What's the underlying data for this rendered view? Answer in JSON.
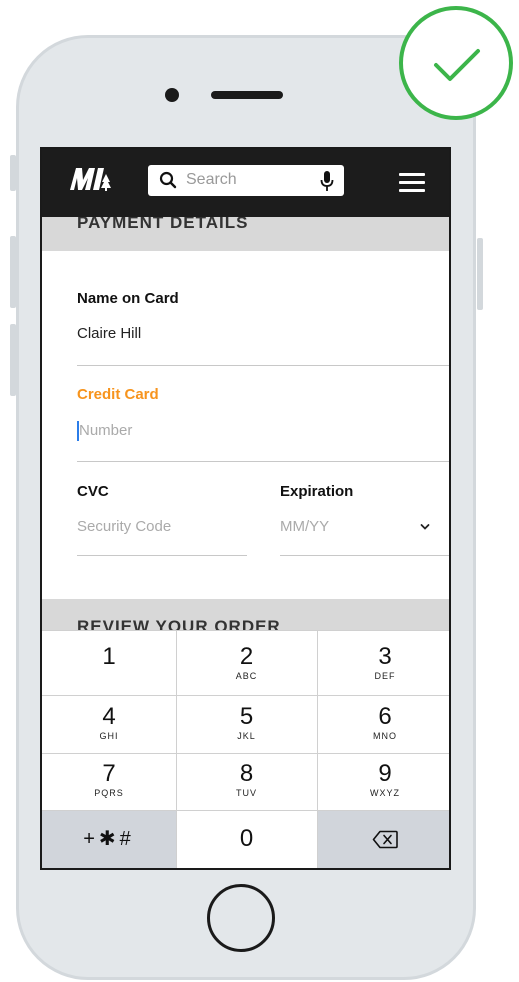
{
  "app": {
    "search_placeholder": "Search"
  },
  "payment": {
    "heading": "PAYMENT DETAILS",
    "name_label": "Name on Card",
    "name_value": "Claire Hill",
    "card_label": "Credit Card",
    "card_placeholder": "Number",
    "cvc_label": "CVC",
    "cvc_placeholder": "Security  Code",
    "expiration_label": "Expiration",
    "expiration_placeholder": "MM/YY"
  },
  "review": {
    "heading": "REVIEW YOUR ORDER"
  },
  "keypad": {
    "keys": [
      {
        "digit": "1",
        "letters": ""
      },
      {
        "digit": "2",
        "letters": "ABC"
      },
      {
        "digit": "3",
        "letters": "DEF"
      },
      {
        "digit": "4",
        "letters": "GHI"
      },
      {
        "digit": "5",
        "letters": "JKL"
      },
      {
        "digit": "6",
        "letters": "MNO"
      },
      {
        "digit": "7",
        "letters": "PQRS"
      },
      {
        "digit": "8",
        "letters": "TUV"
      },
      {
        "digit": "9",
        "letters": "WXYZ"
      }
    ],
    "symbols": "+✱#",
    "zero": "0"
  },
  "colors": {
    "accent": "#f7941d",
    "success": "#3cb54a",
    "topbar": "#1c1c1c"
  }
}
